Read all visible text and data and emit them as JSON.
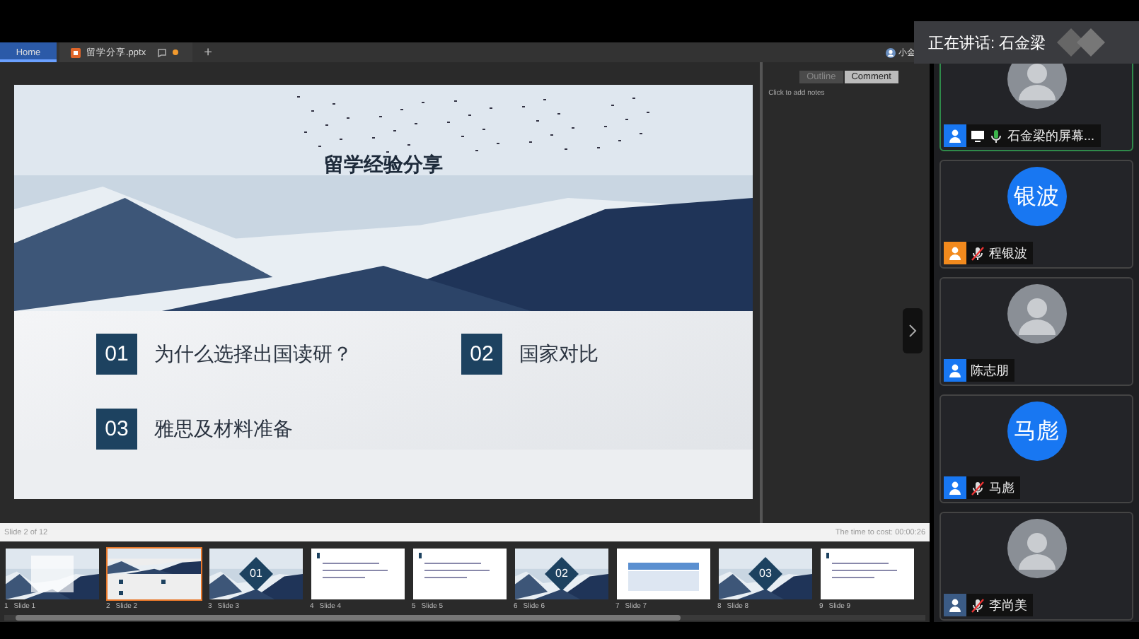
{
  "tabs": [
    {
      "label": "Home",
      "selected": true,
      "kind": "home"
    },
    {
      "label": "留学分享.pptx",
      "selected": false,
      "kind": "file",
      "modified": true
    }
  ],
  "new_tab": "+",
  "user": "小金",
  "slide": {
    "title": "留学经验分享",
    "items": [
      {
        "number": "01",
        "text": "为什么选择出国读研？"
      },
      {
        "number": "02",
        "text": "国家对比"
      },
      {
        "number": "03",
        "text": "雅思及材料准备"
      }
    ]
  },
  "notes": {
    "tabs": [
      {
        "label": "Outline",
        "selected": false
      },
      {
        "label": "Comment",
        "selected": true
      }
    ],
    "placeholder": "Click to add notes"
  },
  "status": {
    "slide": "Slide 2 of 12",
    "timer": "The time to cost: 00:00:26"
  },
  "thumbnails": [
    {
      "number": "1",
      "label": "Slide 1",
      "kind": "cover",
      "selected": false
    },
    {
      "number": "2",
      "label": "Slide 2",
      "kind": "agenda",
      "selected": true
    },
    {
      "number": "3",
      "label": "Slide 3",
      "kind": "section",
      "badge": "01",
      "selected": false
    },
    {
      "number": "4",
      "label": "Slide 4",
      "kind": "text",
      "selected": false
    },
    {
      "number": "5",
      "label": "Slide 5",
      "kind": "text",
      "selected": false
    },
    {
      "number": "6",
      "label": "Slide 6",
      "kind": "section",
      "badge": "02",
      "selected": false
    },
    {
      "number": "7",
      "label": "Slide 7",
      "kind": "table",
      "selected": false
    },
    {
      "number": "8",
      "label": "Slide 8",
      "kind": "section",
      "badge": "03",
      "selected": false
    },
    {
      "number": "9",
      "label": "Slide 9",
      "kind": "text",
      "selected": false
    }
  ],
  "speaking": "正在讲话: 石金梁",
  "participants": [
    {
      "name": "石金梁的屏幕...",
      "color": "#1877f2",
      "sharing": true,
      "muted": false,
      "active": true
    },
    {
      "name": "程银波",
      "kind": "initials",
      "initials": "银波",
      "color": "#f28a1d",
      "sharing": false,
      "muted": true,
      "active": false
    },
    {
      "name": "陈志朋",
      "color": "#1877f2",
      "sharing": false,
      "active": false
    },
    {
      "name": "马彪",
      "kind": "initials",
      "initials": "马彪",
      "color": "#1877f2",
      "sharing": false,
      "muted": true,
      "active": false
    },
    {
      "name": "李尚美",
      "color": "#3b5b85",
      "sharing": false,
      "muted": true,
      "active": false
    }
  ]
}
